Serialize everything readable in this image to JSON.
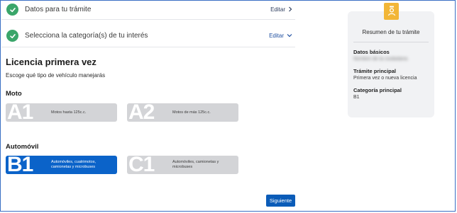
{
  "steps": [
    {
      "title": "Datos para tu trámite",
      "action": "Editar"
    },
    {
      "title": "Selecciona la categoría(s) de tu interés",
      "action": "Editar"
    }
  ],
  "main": {
    "title": "Licencia primera vez",
    "subtitle": "Escoge qué tipo de vehículo manejarás",
    "groups": [
      {
        "label": "Moto",
        "cards": [
          {
            "code": "A1",
            "desc": "Motos hasta 125c.c.",
            "selected": false
          },
          {
            "code": "A2",
            "desc": "Motos de más 125c.c.",
            "selected": false
          }
        ]
      },
      {
        "label": "Automóvil",
        "cards": [
          {
            "code": "B1",
            "desc": "Automóviles, cuatrimotos, camionetas y microbuses",
            "selected": true
          },
          {
            "code": "C1",
            "desc": "Automóviles, camionetas y microbuses",
            "selected": false
          }
        ]
      }
    ],
    "next_label": "Siguiente"
  },
  "summary": {
    "title": "Resumen de tu trámite",
    "items": [
      {
        "label": "Datos básicos",
        "value": "Nombre de la ciudadana"
      },
      {
        "label": "Trámite principal",
        "value": "Primera vez o nueva licencia"
      },
      {
        "label": "Categoría principal",
        "value": "B1"
      }
    ]
  },
  "colors": {
    "accent": "#0b63c9",
    "success": "#3aa66a",
    "summary_icon": "#f2b637"
  },
  "icons": [
    "check-icon",
    "chevron-right-icon",
    "chevron-down-icon",
    "id-card-icon"
  ]
}
